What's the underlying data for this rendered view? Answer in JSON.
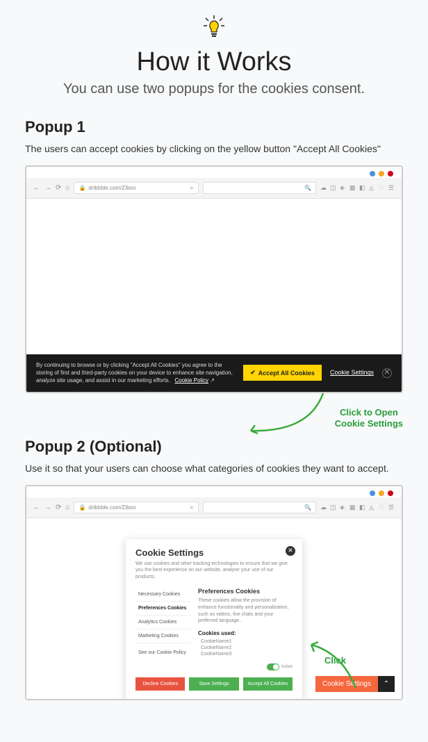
{
  "header": {
    "title": "How it Works",
    "subtitle": "You can use two popups for the cookies consent."
  },
  "popup1": {
    "title": "Popup 1",
    "desc": "The users can accept cookies by clicking on the yellow button \"Accept All Cookies\"",
    "url": "dribbble.com/Zibon",
    "bar_text": "By continuing to browse or by clicking \"Accept All Cookies\" you agree to the storing of first and third-party cookies on your device to enhance site navigation, analyze site usage, and assist in our marketing efforts.",
    "policy_link": "Cookie Policy",
    "accept_btn": "Accept All Cookies",
    "settings_link": "Cookie Settings",
    "annotation": "Click to Open\nCookie Settings"
  },
  "popup2": {
    "title": "Popup 2 (Optional)",
    "desc": "Use it so that your users can choose what categories of cookies they want to accept.",
    "url": "dribbble.com/Zibon",
    "modal": {
      "title": "Cookie Settings",
      "desc": "We use cookies and other tracking technologies to ensure that we give you the best experience on our website, analyse your use of our products.",
      "tabs": [
        "Necessary Cookies",
        "Preferences Cookies",
        "Analytics Cookies",
        "Marketing Cookies",
        "See our Cookie Policy"
      ],
      "panel_title": "Preferences Cookies",
      "panel_desc": "These cookies allow the provision of enhance functionality and personalization, such as videos, live chats and your preferred language..",
      "cookies_title": "Cookies used:",
      "cookies": [
        "CookieName1",
        "CookieName2",
        "CookieName3"
      ],
      "toggle_label": "Active",
      "decline": "Decline Cookies",
      "save": "Save Settings",
      "accept": "Accept All Cookies"
    },
    "float_btn": "Cookie Settings",
    "annotation": "Click"
  }
}
